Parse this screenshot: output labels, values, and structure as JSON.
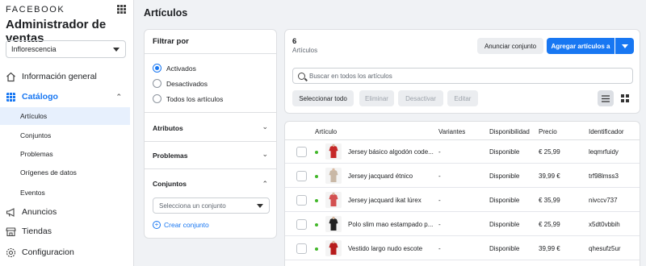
{
  "sidebar": {
    "brand": "FACEBOOK",
    "app_title": "Administrador de ventas",
    "account": "Inflorescencia",
    "nav": [
      {
        "label": "Información general",
        "icon": "home-icon"
      },
      {
        "label": "Catálogo",
        "icon": "catalog-icon"
      },
      {
        "label": "Anuncios",
        "icon": "megaphone-icon"
      },
      {
        "label": "Tiendas",
        "icon": "shop-icon"
      },
      {
        "label": "Configuracion",
        "icon": "gear-icon"
      }
    ],
    "catalog_sub": [
      "Artículos",
      "Conjuntos",
      "Problemas",
      "Orígenes de datos",
      "Eventos"
    ]
  },
  "main": {
    "page_title": "Artículos"
  },
  "filter": {
    "title": "Filtrar por",
    "options": [
      "Activados",
      "Desactivados",
      "Todos los artículos"
    ],
    "selected": "Activados",
    "sections": [
      "Atributos",
      "Problemas",
      "Conjuntos"
    ],
    "set_placeholder": "Selecciona un conjunto",
    "create_set": "Crear conjunto"
  },
  "toolbar": {
    "count": "6",
    "count_label": "Artículos",
    "advertise_set": "Anunciar conjunto",
    "add_items": "Agregar artículos a",
    "search_placeholder": "Buscar en todos los artículos",
    "select_all": "Seleccionar todo",
    "delete": "Eliminar",
    "deactivate": "Desactivar",
    "edit": "Editar"
  },
  "table": {
    "headers": [
      "Artículo",
      "Variantes",
      "Disponibilidad",
      "Precio",
      "Identificador"
    ],
    "rows": [
      {
        "name": "Jersey básico algodón code...",
        "variants": "-",
        "availability": "Disponible",
        "price": "€ 25,99",
        "id": "leqmrfuidy",
        "color": "#c62828"
      },
      {
        "name": "Jersey jacquard étnico",
        "variants": "-",
        "availability": "Disponible",
        "price": "39,99 €",
        "id": "trf98lmss3",
        "color": "#c9b8a6"
      },
      {
        "name": "Jersey jacquard ikat lúrex",
        "variants": "-",
        "availability": "Disponible",
        "price": "€ 35,99",
        "id": "nivccv737",
        "color": "#d35050"
      },
      {
        "name": "Polo slim mao estampado p...",
        "variants": "-",
        "availability": "Disponible",
        "price": "€ 25,99",
        "id": "x5dt0vbbih",
        "color": "#222222"
      },
      {
        "name": "Vestido largo nudo escote",
        "variants": "-",
        "availability": "Disponible",
        "price": "39,99 €",
        "id": "qhesufz5ur",
        "color": "#b71c1c"
      }
    ]
  },
  "colors": {
    "accent": "#1877f2",
    "active_dot": "#42b72a",
    "background": "#f0f2f5"
  }
}
